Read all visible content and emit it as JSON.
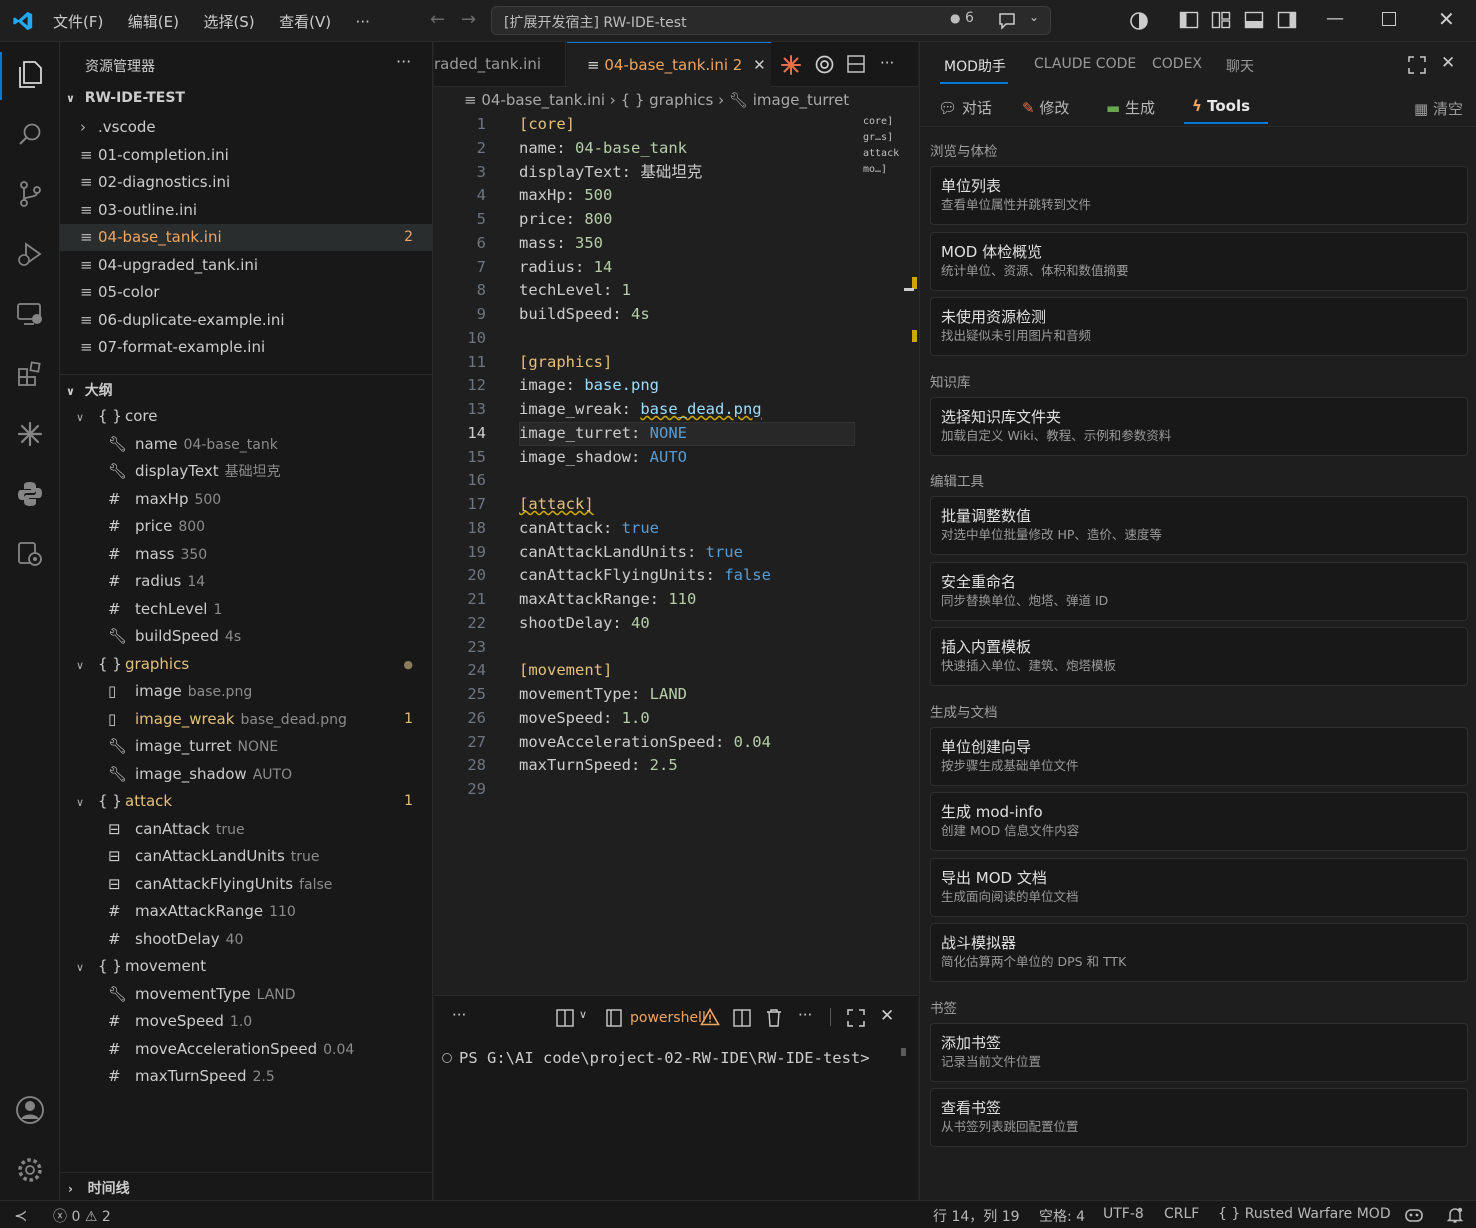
{
  "titlebar": {
    "menus": [
      "文件(F)",
      "编辑(E)",
      "选择(S)",
      "查看(V)"
    ],
    "more": "···",
    "command_center": "[扩展开发宿主] RW-IDE-test",
    "copilot_count": "6"
  },
  "sidebar": {
    "title": "资源管理器",
    "project": "RW-IDE-TEST",
    "files": [
      {
        "name": ".vscode",
        "folder": true
      },
      {
        "name": "01-completion.ini"
      },
      {
        "name": "02-diagnostics.ini"
      },
      {
        "name": "03-outline.ini"
      },
      {
        "name": "04-base_tank.ini",
        "active": true,
        "badge": "2"
      },
      {
        "name": "04-upgraded_tank.ini"
      },
      {
        "name": "05-color"
      },
      {
        "name": "06-duplicate-example.ini"
      },
      {
        "name": "07-format-example.ini"
      }
    ],
    "outline_title": "大纲",
    "outline": [
      {
        "level": 0,
        "kind": "section",
        "name": "core"
      },
      {
        "level": 1,
        "kind": "key",
        "name": "name",
        "value": "04-base_tank"
      },
      {
        "level": 1,
        "kind": "key",
        "name": "displayText",
        "value": "基础坦克"
      },
      {
        "level": 1,
        "kind": "num",
        "name": "maxHp",
        "value": "500"
      },
      {
        "level": 1,
        "kind": "num",
        "name": "price",
        "value": "800"
      },
      {
        "level": 1,
        "kind": "num",
        "name": "mass",
        "value": "350"
      },
      {
        "level": 1,
        "kind": "num",
        "name": "radius",
        "value": "14"
      },
      {
        "level": 1,
        "kind": "num",
        "name": "techLevel",
        "value": "1"
      },
      {
        "level": 1,
        "kind": "key",
        "name": "buildSpeed",
        "value": "4s"
      },
      {
        "level": 0,
        "kind": "section",
        "name": "graphics",
        "warn": true,
        "dot": true
      },
      {
        "level": 1,
        "kind": "file",
        "name": "image",
        "value": "base.png"
      },
      {
        "level": 1,
        "kind": "file",
        "name": "image_wreak",
        "value": "base_dead.png",
        "warn": true,
        "badge": "1"
      },
      {
        "level": 1,
        "kind": "key",
        "name": "image_turret",
        "value": "NONE"
      },
      {
        "level": 1,
        "kind": "key",
        "name": "image_shadow",
        "value": "AUTO"
      },
      {
        "level": 0,
        "kind": "section",
        "name": "attack",
        "warn": true,
        "badge": "1"
      },
      {
        "level": 1,
        "kind": "bool",
        "name": "canAttack",
        "value": "true"
      },
      {
        "level": 1,
        "kind": "bool",
        "name": "canAttackLandUnits",
        "value": "true"
      },
      {
        "level": 1,
        "kind": "bool",
        "name": "canAttackFlyingUnits",
        "value": "false"
      },
      {
        "level": 1,
        "kind": "num",
        "name": "maxAttackRange",
        "value": "110"
      },
      {
        "level": 1,
        "kind": "num",
        "name": "shootDelay",
        "value": "40"
      },
      {
        "level": 0,
        "kind": "section",
        "name": "movement"
      },
      {
        "level": 1,
        "kind": "key",
        "name": "movementType",
        "value": "LAND"
      },
      {
        "level": 1,
        "kind": "num",
        "name": "moveSpeed",
        "value": "1.0"
      },
      {
        "level": 1,
        "kind": "num",
        "name": "moveAccelerationSpeed",
        "value": "0.04"
      },
      {
        "level": 1,
        "kind": "num",
        "name": "maxTurnSpeed",
        "value": "2.5"
      }
    ],
    "timeline": "时间线"
  },
  "editor": {
    "tab_prev": "raded_tank.ini",
    "tab_active": "04-base_tank.ini",
    "tab_badge": "2",
    "breadcrumb": [
      "04-base_tank.ini",
      "{ } graphics",
      "image_turret"
    ],
    "minimap": [
      "core]",
      "gr…s]",
      "attack",
      "mo…]"
    ],
    "lines": [
      [
        {
          "t": "[core]",
          "c": "sec"
        }
      ],
      [
        {
          "t": "name: ",
          "c": "k"
        },
        {
          "t": "04-base_tank",
          "c": "v"
        }
      ],
      [
        {
          "t": "displayText: ",
          "c": "k"
        },
        {
          "t": "基础坦克",
          "c": "k"
        }
      ],
      [
        {
          "t": "maxHp: ",
          "c": "k"
        },
        {
          "t": "500",
          "c": "v"
        }
      ],
      [
        {
          "t": "price: ",
          "c": "k"
        },
        {
          "t": "800",
          "c": "v"
        }
      ],
      [
        {
          "t": "mass: ",
          "c": "k"
        },
        {
          "t": "350",
          "c": "v"
        }
      ],
      [
        {
          "t": "radius: ",
          "c": "k"
        },
        {
          "t": "14",
          "c": "v"
        }
      ],
      [
        {
          "t": "techLevel: ",
          "c": "k"
        },
        {
          "t": "1",
          "c": "v"
        }
      ],
      [
        {
          "t": "buildSpeed: ",
          "c": "k"
        },
        {
          "t": "4s",
          "c": "v"
        }
      ],
      [],
      [
        {
          "t": "[graphics]",
          "c": "sec"
        }
      ],
      [
        {
          "t": "image: ",
          "c": "k"
        },
        {
          "t": "base.png",
          "c": "s"
        }
      ],
      [
        {
          "t": "image_wreak: ",
          "c": "k"
        },
        {
          "t": "base_dead.png",
          "c": "s"
        }
      ],
      [
        {
          "t": "image_turret: ",
          "c": "k"
        },
        {
          "t": "NONE",
          "c": "b"
        }
      ],
      [
        {
          "t": "image_shadow: ",
          "c": "k"
        },
        {
          "t": "AUTO",
          "c": "b"
        }
      ],
      [],
      [
        {
          "t": "[attack]",
          "c": "sec"
        }
      ],
      [
        {
          "t": "canAttack: ",
          "c": "k"
        },
        {
          "t": "true",
          "c": "b"
        }
      ],
      [
        {
          "t": "canAttackLandUnits: ",
          "c": "k"
        },
        {
          "t": "true",
          "c": "b"
        }
      ],
      [
        {
          "t": "canAttackFlyingUnits: ",
          "c": "k"
        },
        {
          "t": "false",
          "c": "b"
        }
      ],
      [
        {
          "t": "maxAttackRange: ",
          "c": "k"
        },
        {
          "t": "110",
          "c": "v"
        }
      ],
      [
        {
          "t": "shootDelay: ",
          "c": "k"
        },
        {
          "t": "40",
          "c": "v"
        }
      ],
      [],
      [
        {
          "t": "[movement]",
          "c": "sec"
        }
      ],
      [
        {
          "t": "movementType: ",
          "c": "k"
        },
        {
          "t": "LAND",
          "c": "v"
        }
      ],
      [
        {
          "t": "moveSpeed: ",
          "c": "k"
        },
        {
          "t": "1.0",
          "c": "v"
        }
      ],
      [
        {
          "t": "moveAccelerationSpeed: ",
          "c": "k"
        },
        {
          "t": "0.04",
          "c": "v"
        }
      ],
      [
        {
          "t": "maxTurnSpeed: ",
          "c": "k"
        },
        {
          "t": "2.5",
          "c": "v"
        }
      ],
      []
    ]
  },
  "terminal": {
    "more": "···",
    "shell": "powershell",
    "prompt": "PS G:\\AI code\\project-02-RW-IDE\\RW-IDE-test>"
  },
  "panel": {
    "tabs": [
      "MOD助手",
      "CLAUDE CODE",
      "CODEX",
      "聊天"
    ],
    "subtabs": [
      "对话",
      "修改",
      "生成",
      "Tools"
    ],
    "clear": "清空",
    "groups": [
      {
        "title": "浏览与体检",
        "cards": [
          {
            "t": "单位列表",
            "d": "查看单位属性并跳转到文件"
          },
          {
            "t": "MOD 体检概览",
            "d": "统计单位、资源、体积和数值摘要"
          },
          {
            "t": "未使用资源检测",
            "d": "找出疑似未引用图片和音频"
          }
        ]
      },
      {
        "title": "知识库",
        "cards": [
          {
            "t": "选择知识库文件夹",
            "d": "加载自定义 Wiki、教程、示例和参数资料"
          }
        ]
      },
      {
        "title": "编辑工具",
        "cards": [
          {
            "t": "批量调整数值",
            "d": "对选中单位批量修改 HP、造价、速度等"
          },
          {
            "t": "安全重命名",
            "d": "同步替换单位、炮塔、弹道 ID"
          },
          {
            "t": "插入内置模板",
            "d": "快速插入单位、建筑、炮塔模板"
          }
        ]
      },
      {
        "title": "生成与文档",
        "cards": [
          {
            "t": "单位创建向导",
            "d": "按步骤生成基础单位文件"
          },
          {
            "t": "生成 mod-info",
            "d": "创建 MOD 信息文件内容"
          },
          {
            "t": "导出 MOD 文档",
            "d": "生成面向阅读的单位文档"
          },
          {
            "t": "战斗模拟器",
            "d": "简化估算两个单位的 DPS 和 TTK"
          }
        ]
      },
      {
        "title": "书签",
        "cards": [
          {
            "t": "添加书签",
            "d": "记录当前文件位置"
          },
          {
            "t": "查看书签",
            "d": "从书签列表跳回配置位置"
          }
        ]
      }
    ]
  },
  "status": {
    "errors": "0",
    "warnings": "2",
    "position": "行 14，列 19",
    "spaces": "空格: 4",
    "encoding": "UTF-8",
    "eol": "CRLF",
    "language": "{ } Rusted Warfare MOD"
  },
  "colors": {
    "accent": "#0078d4",
    "warning": "#cca700",
    "section": "#e5c07b",
    "active_tab": "#f0a560"
  }
}
